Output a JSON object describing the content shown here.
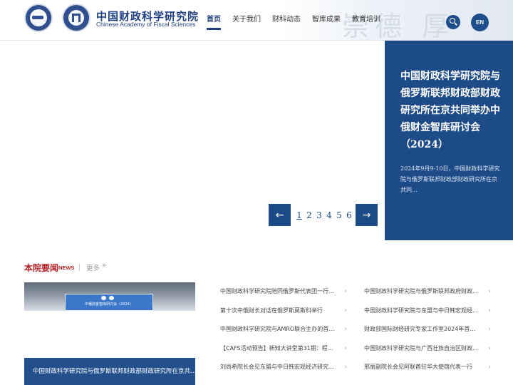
{
  "header": {
    "brand_cn": "中国财政科学研究院",
    "brand_en": "Chinese Academy of Fiscal Sciences",
    "calligraphy": "崇德 厚",
    "nav": [
      "首页",
      "关于我们",
      "财科动态",
      "智库成果",
      "教育培训"
    ],
    "active_nav": "首页",
    "lang_label": "EN"
  },
  "banner": {
    "slide_title": "中国财政科学研究院与俄罗斯联邦财政部财政研究所在京共同举办中俄财金智库研讨会（2024）",
    "slide_summary": "2024年9月9-10日，中国财政科学研究院与俄罗斯联邦财政部财政研究所在京共同...",
    "prev_icon": "←",
    "next_icon": "→",
    "pages": [
      "1",
      "2",
      "3",
      "4",
      "5",
      "6"
    ],
    "current_page": "1"
  },
  "news": {
    "title": "本院要闻",
    "subtitle": "NEWS",
    "more": "更多",
    "photo_caption": "中国财政科学研究院与俄罗斯联邦财政部财政研究所在京共...",
    "photo_screen_text": "中俄财金智库研讨会（2024）",
    "col1": [
      "中国财政科学研究院陪同俄罗斯代表团一行...",
      "第十次中俄财长对话在俄罗斯莫斯科举行",
      "中国财政科学研究院与AMRO联合主办的首...",
      "【CAFS活动预告】新知大讲堂第31期：程...",
      "刘尚希院长会见东盟与中日韩宏观经济研究..."
    ],
    "col2": [
      "中国财政科学研究院与俄罗斯联邦政府财政...",
      "中国财政科学研究院与东盟与中日韩宏观经...",
      "财政部国际财经研究专家工作室2024年首次...",
      "中国财政科学研究院与广西壮族自治区财政...",
      "邢丽副院长会见阿联酋驻华大使馆代表一行"
    ],
    "arrow_icon": "›"
  }
}
